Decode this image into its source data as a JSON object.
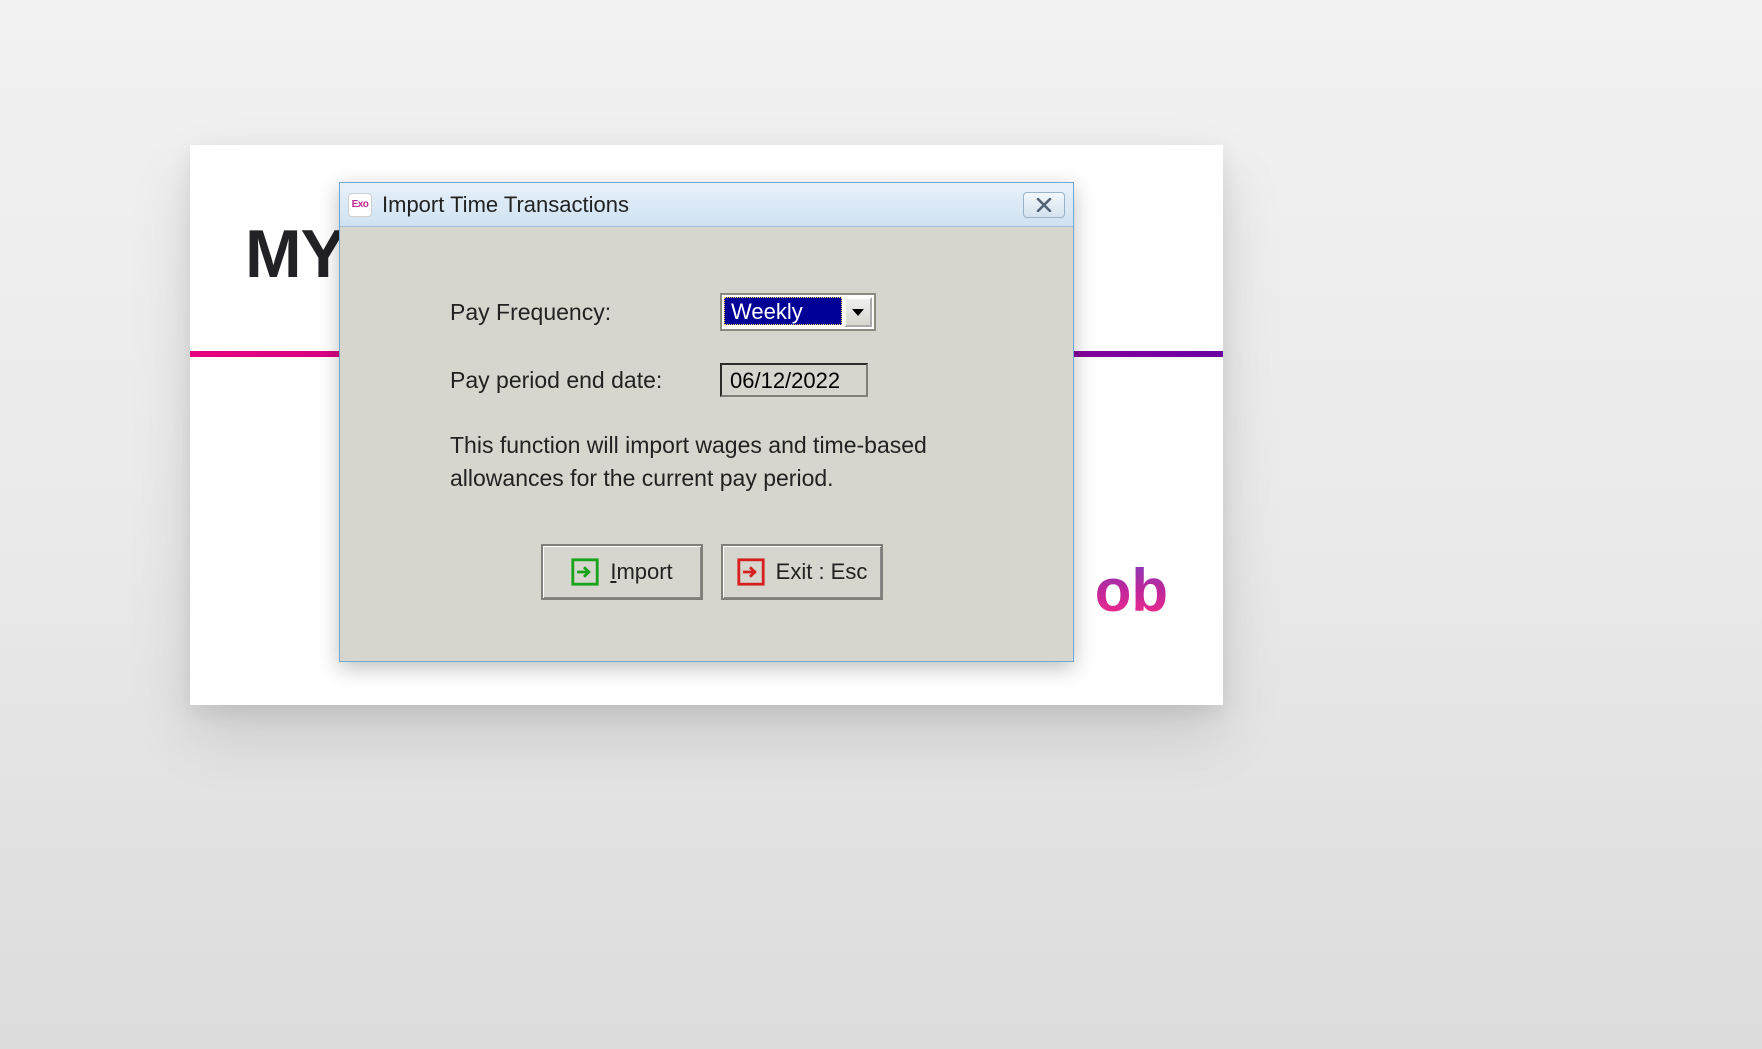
{
  "background": {
    "title_fragment": "MY",
    "logo_fragment": "ob"
  },
  "dialog": {
    "app_icon_text": "Exo",
    "title": "Import Time Transactions",
    "pay_frequency_label": "Pay Frequency:",
    "pay_frequency_value": "Weekly",
    "pay_period_label": "Pay period end date:",
    "pay_period_value": "06/12/2022",
    "description": "This function will import wages and time-based allowances for the current pay period.",
    "import_button": "Import",
    "exit_button": "Exit : Esc"
  }
}
